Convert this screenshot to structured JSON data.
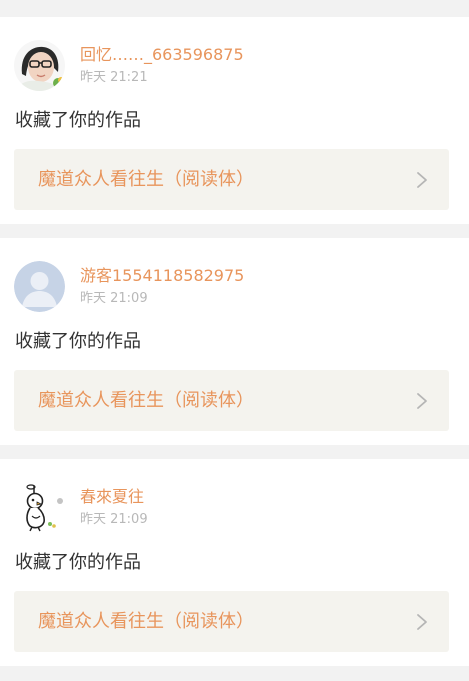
{
  "notifications": [
    {
      "username": "回忆……_663596875",
      "time": "昨天 21:21",
      "action": "收藏了你的作品",
      "work_title": "魔道众人看往生（阅读体）",
      "avatar_icon": "user-photo-avatar"
    },
    {
      "username": "游客1554118582975",
      "time": "昨天 21:09",
      "action": "收藏了你的作品",
      "work_title": "魔道众人看往生（阅读体）",
      "avatar_icon": "default-user-avatar"
    },
    {
      "username": "春來夏往",
      "time": "昨天 21:09",
      "action": "收藏了你的作品",
      "work_title": "魔道众人看往生（阅读体）",
      "avatar_icon": "cartoon-bird-avatar"
    }
  ],
  "colors": {
    "accent": "#e8955c",
    "background": "#f2f2f2",
    "card": "#ffffff",
    "link_box": "#f4f3ee",
    "time_text": "#b8b8b8",
    "body_text": "#333333"
  }
}
